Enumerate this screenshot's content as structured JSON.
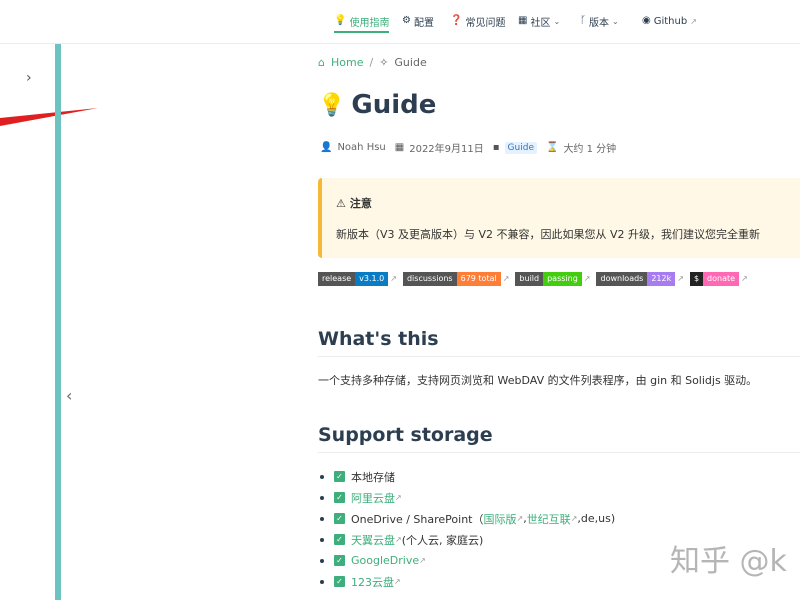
{
  "nav": {
    "items": [
      {
        "label": "使用指南",
        "icon": "lightbulb-icon",
        "glyph": "💡",
        "active": true
      },
      {
        "label": "配置",
        "icon": "gear-icon",
        "glyph": "⚙",
        "active": false
      },
      {
        "label": "常见问题",
        "icon": "question-icon",
        "glyph": "❓",
        "active": false
      },
      {
        "label": "社区",
        "icon": "community-icon",
        "glyph": "▦",
        "active": false,
        "dropdown": true
      },
      {
        "label": "版本",
        "icon": "branch-icon",
        "glyph": "ᚴ",
        "active": false,
        "dropdown": true
      },
      {
        "label": "Github",
        "icon": "github-icon",
        "glyph": "◉",
        "active": false,
        "external": true
      }
    ]
  },
  "breadcrumb": {
    "home": "Home",
    "sep": "/",
    "current": "Guide"
  },
  "page": {
    "title": "Guide"
  },
  "meta": {
    "author": "Noah Hsu",
    "date": "2022年9月11日",
    "category": "Guide",
    "reading_time": "大约 1 分钟"
  },
  "warning": {
    "title": "注意",
    "text": "新版本（V3 及更高版本）与 V2 不兼容，因此如果您从 V2 升级，我们建议您完全重新"
  },
  "badges": [
    {
      "left": "release",
      "right": "v3.1.0",
      "color": "#0a7cc4"
    },
    {
      "left": "discussions",
      "right": "679 total",
      "color": "#fe7d37"
    },
    {
      "left": "build",
      "right": "passing",
      "color": "#4c1"
    },
    {
      "left": "downloads",
      "right": "212k",
      "color": "#a77cf0"
    },
    {
      "left": "$",
      "right": "donate",
      "color": "#ff69b4"
    }
  ],
  "sections": {
    "whats_this": "What's this",
    "whats_this_text": "一个支持多种存储，支持网页浏览和 WebDAV 的文件列表程序，由 gin 和 Solidjs 驱动。",
    "support_storage": "Support storage"
  },
  "storage": [
    {
      "text": "本地存储",
      "link": false
    },
    {
      "text": "阿里云盘",
      "link": true
    },
    {
      "text": "OneDrive / SharePoint（",
      "link": false,
      "extra_links": [
        "国际版",
        "世纪互联"
      ],
      "tail": ",de,us)"
    },
    {
      "text": "天翼云盘",
      "link": true,
      "tail": " (个人云, 家庭云)"
    },
    {
      "text": "GoogleDrive",
      "link": true
    },
    {
      "text": "123云盘",
      "link": true
    }
  ],
  "watermark": "知乎 @k",
  "colors": {
    "accent": "#3eaf7c",
    "sidebar": "#6cc3c1",
    "warning_bg": "#fff8e6",
    "warning_border": "#f5b937"
  }
}
